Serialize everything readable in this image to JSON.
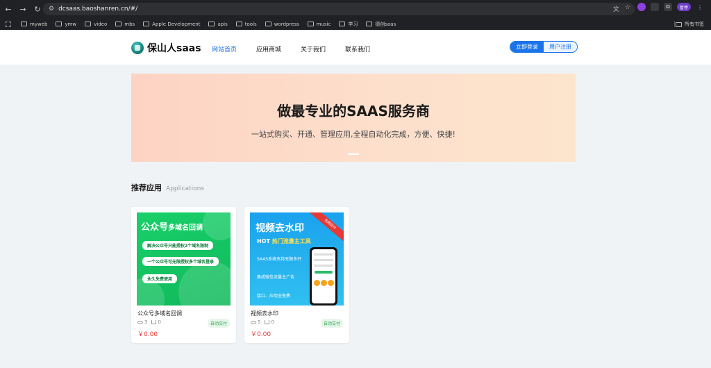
{
  "browser": {
    "url": "dcsaas.baoshanren.cn/#/",
    "profile_label": "暂停",
    "bookmarks": [
      {
        "label": "myweb"
      },
      {
        "label": "ymw"
      },
      {
        "label": "video"
      },
      {
        "label": "mbs"
      },
      {
        "label": "Apple Development"
      },
      {
        "label": "apis"
      },
      {
        "label": "tools"
      },
      {
        "label": "wordpress"
      },
      {
        "label": "music"
      },
      {
        "label": "学习"
      },
      {
        "label": "德创saas"
      }
    ],
    "all_bookmarks": "所有书签"
  },
  "header": {
    "logo_text": "保山人saas",
    "nav": [
      {
        "label": "网站首页",
        "active": true
      },
      {
        "label": "应用商城"
      },
      {
        "label": "关于我们"
      },
      {
        "label": "联系我们"
      }
    ],
    "login_label": "立即登录",
    "register_label": "用户注册",
    "accent_color": "#1a73e8"
  },
  "banner": {
    "title": "做最专业的SAAS服务商",
    "subtitle": "一站式购买、开通、管理应用,全程自动化完成，方便、快捷!"
  },
  "section": {
    "title": "推荐应用",
    "subtitle": "Applications"
  },
  "apps": [
    {
      "name": "公众号多域名回调",
      "views": "3",
      "sales": "0",
      "badge": "自动交付",
      "price": "￥0.00",
      "thumb": {
        "title_main": "公众号",
        "title_small": "多域名回调",
        "pills": [
          "解决公众号只能授权2个域名限制",
          "一个公众号可无限授权多个域名登录",
          "永久免费使用"
        ]
      }
    },
    {
      "name": "视频去水印",
      "views": "5",
      "sales": "0",
      "badge": "自动交付",
      "price": "￥0.00",
      "thumb": {
        "title": "视频去水印",
        "hot_prefix": "HOT",
        "hot_text": "热门流量主工具",
        "ribbon": "先用后付",
        "lines": [
          "SAAS系统支持无限多开",
          "集成微信流量主广告",
          "接口、应用全免费"
        ]
      }
    }
  ]
}
